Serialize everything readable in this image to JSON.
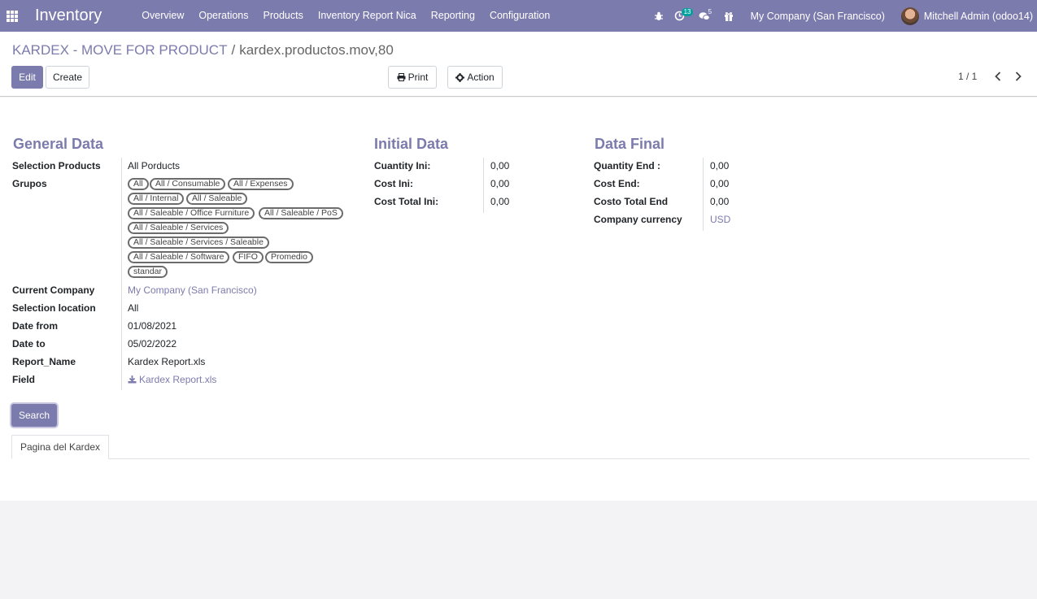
{
  "navbar": {
    "brand": "Inventory",
    "menu": [
      "Overview",
      "Operations",
      "Products",
      "Inventory Report Nica",
      "Reporting",
      "Configuration"
    ],
    "activity_count": "13",
    "messages_count": "5",
    "company": "My Company (San Francisco)",
    "user": "Mitchell Admin (odoo14)"
  },
  "breadcrumb": {
    "parent": "KARDEX - MOVE FOR PRODUCT",
    "separator": "/",
    "current": "kardex.productos.mov,80"
  },
  "toolbar": {
    "edit_label": "Edit",
    "create_label": "Create",
    "print_label": "Print",
    "action_label": "Action",
    "pager": "1 / 1"
  },
  "general": {
    "title": "General Data",
    "selection_products_label": "Selection Products",
    "selection_products_value": "All Porducts",
    "grupos_label": "Grupos",
    "tags": [
      "All",
      "All / Consumable",
      "All / Expenses",
      "All / Internal",
      "All / Saleable",
      "All / Saleable / Office Furniture",
      "All / Saleable / PoS",
      "All / Saleable / Services",
      "All / Saleable / Services / Saleable",
      "All / Saleable / Software",
      "FIFO",
      "Promedio",
      "standar"
    ],
    "current_company_label": "Current Company",
    "current_company_value": "My Company (San Francisco)",
    "selection_location_label": "Selection location",
    "selection_location_value": "All",
    "date_from_label": "Date from",
    "date_from_value": "01/08/2021",
    "date_to_label": "Date to",
    "date_to_value": "05/02/2022",
    "report_name_label": "Report_Name",
    "report_name_value": "Kardex Report.xls",
    "field_label": "Field",
    "field_value": "Kardex Report.xls"
  },
  "initial": {
    "title": "Initial Data",
    "qty_label": "Cuantity Ini:",
    "qty_value": "0,00",
    "cost_label": "Cost Ini:",
    "cost_value": "0,00",
    "total_label": "Cost Total Ini:",
    "total_value": "0,00"
  },
  "final": {
    "title": "Data Final",
    "qty_label": "Quantity End :",
    "qty_value": "0,00",
    "cost_label": "Cost End:",
    "cost_value": "0,00",
    "total_label": "Costo Total End",
    "total_value": "0,00",
    "currency_label": "Company currency",
    "currency_value": "USD"
  },
  "search_label": "Search",
  "tab_label": "Pagina del Kardex",
  "colors": {
    "brand": "#7c7bad",
    "badge": "#00a09d"
  }
}
